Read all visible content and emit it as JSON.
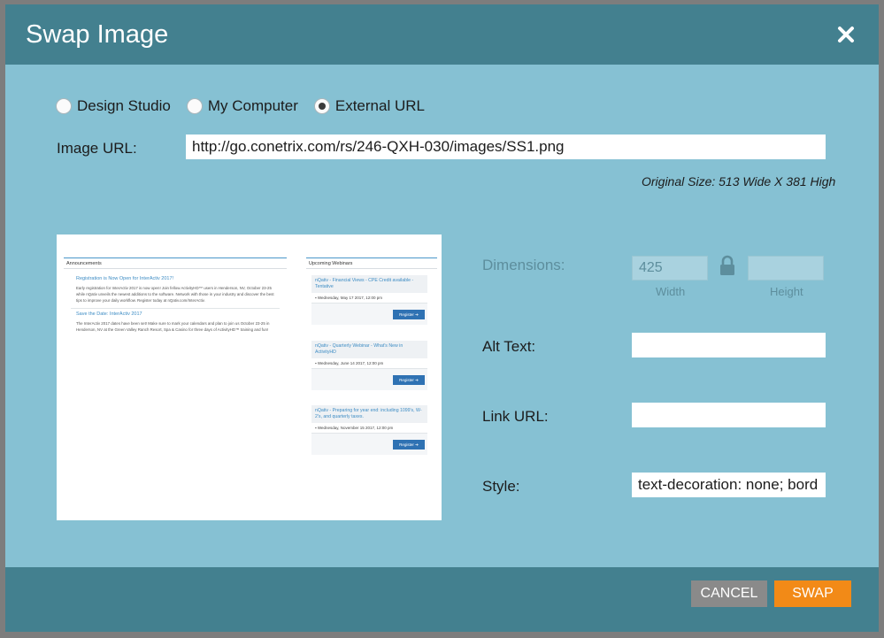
{
  "modal": {
    "title": "Swap Image"
  },
  "source_options": [
    {
      "label": "Design Studio",
      "selected": false
    },
    {
      "label": "My Computer",
      "selected": false
    },
    {
      "label": "External URL",
      "selected": true
    }
  ],
  "image_url": {
    "label": "Image URL:",
    "value": "http://go.conetrix.com/rs/246-QXH-030/images/SS1.png"
  },
  "original_size": "Original Size: 513 Wide X 381 High",
  "dimensions": {
    "label": "Dimensions:",
    "width_value": "425",
    "height_value": "",
    "width_label": "Width",
    "height_label": "Height"
  },
  "alt_text": {
    "label": "Alt Text:",
    "value": ""
  },
  "link_url": {
    "label": "Link URL:",
    "value": ""
  },
  "style": {
    "label": "Style:",
    "value": "text-decoration: none; bord"
  },
  "preview": {
    "announcements": {
      "title": "Announcements",
      "items": [
        {
          "heading": "Registration is Now Open for InterActiv 2017!",
          "body": "Early registration for InterActiv 2017 is now open! Join fellow ActivityHD™ users in Henderson, NV, October 23-25 while nQativ unveils the newest additions to the software. Network with those in your industry and discover the best tips to improve your daily workflow. Register today at nQativ.com/InterActiv."
        },
        {
          "heading": "Save the Date: InterActiv 2017",
          "body": "The InterActiv 2017 dates have been set! Make sure to mark your calendars and plan to join us October 23-25 in Henderson, NV at the Green Valley Ranch Resort, Spa & Casino for three days of ActivityHD™ training and fun!"
        }
      ]
    },
    "webinars": {
      "title": "Upcoming Webinars",
      "items": [
        {
          "title": "nQativ - Financial Views - CPE Credit available - Tentative",
          "date": "Wednesday, May 17 2017, 12:00 pm",
          "button": "Register"
        },
        {
          "title": "nQativ - Quarterly Webinar - What's New in ActivityHD",
          "date": "Wednesday, June 14 2017, 12:00 pm",
          "button": "Register"
        },
        {
          "title": "nQativ - Preparing for year end: including 1099's, W-2's, and quarterly taxes.",
          "date": "Wednesday, November 15 2017, 12:00 pm",
          "button": "Register"
        }
      ]
    }
  },
  "footer": {
    "cancel_label": "CANCEL",
    "swap_label": "SWAP"
  },
  "colors": {
    "header_bg": "#43808f",
    "body_bg": "#86c1d3",
    "swap_button": "#f28a17",
    "cancel_button": "#8a8a8a"
  },
  "icons": {
    "close": "close-icon",
    "lock": "lock-icon",
    "calendar": "calendar-icon",
    "arrow": "arrow-right-icon"
  }
}
